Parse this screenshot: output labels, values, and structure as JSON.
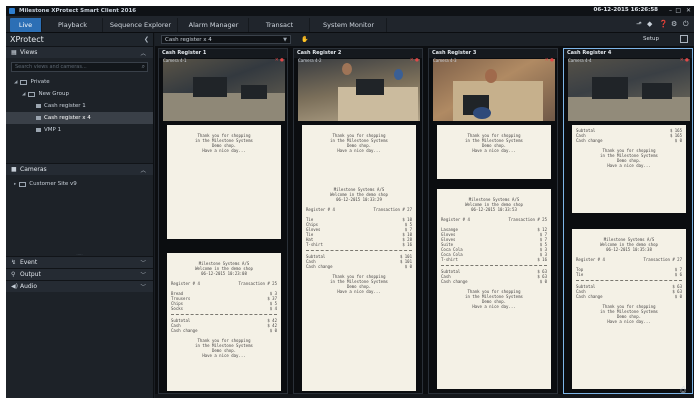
{
  "titlebar": {
    "title": "Milestone XProtect Smart Client 2016",
    "datetime": "06-12-2015 16:26:58"
  },
  "tabs": [
    "Live",
    "Playback",
    "Sequence Explorer",
    "Alarm Manager",
    "Transact",
    "System Monitor"
  ],
  "left": {
    "brand": "XProtect",
    "views_label": "Views",
    "search_placeholder": "Search views and cameras...",
    "tree": {
      "private": "Private",
      "group": "New Group",
      "items": [
        "Cash register 1",
        "Cash register x 4",
        "VMP 1"
      ]
    },
    "cameras_label": "Cameras",
    "site": "Customer Site v9",
    "sections": [
      "Event",
      "Output",
      "Audio"
    ]
  },
  "view": {
    "selected": "Cash register x 4",
    "setup": "Setup"
  },
  "cameras": [
    {
      "title": "Cash Register 1",
      "sub": "Camera 4-1",
      "top": [
        "Thank you for shopping",
        "in the Milestone Systems",
        "Demo shop.",
        "Have a nice day..."
      ],
      "header": [
        "Milestone Systems A/S",
        "Welcome in the demo shop",
        "06-12-2015 10:23:08"
      ],
      "register": [
        "Register # 4",
        "Transaction # 25"
      ],
      "items": [
        [
          "Bread",
          "$ 3"
        ],
        [
          "Trousers",
          "$ 37"
        ],
        [
          "Chips",
          "$ 5"
        ],
        [
          "Socks",
          "$ 4"
        ]
      ],
      "totals": [
        [
          "Subtotal",
          "$ 42"
        ],
        [
          "Cash",
          "$ 42"
        ],
        [
          "Cash change",
          "$ 0"
        ]
      ],
      "bottom": [
        "Thank you for shopping",
        "in the Milestone Systems",
        "Demo shop.",
        "Have a nice day..."
      ]
    },
    {
      "title": "Cash Register 2",
      "sub": "Camera 4-2",
      "top": [
        "Thank you for shopping",
        "in the Milestone Systems",
        "Demo shop.",
        "Have a nice day..."
      ],
      "header": [
        "Milestone Systems A/S",
        "Welcome in the demo shop",
        "06-12-2015 10:33:29"
      ],
      "register": [
        "Register # 4",
        "Transaction # 27"
      ],
      "items": [
        [
          "Tie",
          "$ 10"
        ],
        [
          "Chips",
          "$ 5"
        ],
        [
          "Gloves",
          "$ 7"
        ],
        [
          "Tie",
          "$ 10"
        ],
        [
          "Hat",
          "$ 28"
        ],
        [
          "T-shirt",
          "$ 16"
        ]
      ],
      "totals": [
        [
          "Subtotal",
          "$ 101"
        ],
        [
          "Cash",
          "$ 101"
        ],
        [
          "Cash change",
          "$ 0"
        ]
      ],
      "bottom": [
        "Thank you for shopping",
        "in the Milestone Systems",
        "Demo shop.",
        "Have a nice day..."
      ]
    },
    {
      "title": "Cash Register 3",
      "sub": "Camera 4-3",
      "top": [
        "Thank you for shopping",
        "in the Milestone Systems",
        "Demo shop.",
        "Have a nice day..."
      ],
      "header": [
        "Milestone Systems A/S",
        "Welcome in the demo shop",
        "06-12-2015 10:33:53"
      ],
      "register": [
        "Register # 4",
        "Transaction # 25"
      ],
      "items": [
        [
          "Lasange",
          "$ 12"
        ],
        [
          "Gloves",
          "$ 7"
        ],
        [
          "Gloves",
          "$ 7"
        ],
        [
          "Suite",
          "$ 5"
        ],
        [
          "Coca Cola",
          "$ 3"
        ],
        [
          "Coca Cola",
          "$ 3"
        ],
        [
          "T-shirt",
          "$ 16"
        ]
      ],
      "totals": [
        [
          "Subtotal",
          "$ 63"
        ],
        [
          "Cash",
          "$ 63"
        ],
        [
          "Cash change",
          "$ 0"
        ]
      ],
      "bottom": [
        "Thank you for shopping",
        "in the Milestone Systems",
        "Demo shop.",
        "Have a nice day..."
      ]
    },
    {
      "title": "Cash Register 4",
      "sub": "Camera 4-4",
      "top": [
        "Subtotal",
        "Cash",
        "Cash change"
      ],
      "topvals": [
        "$ 165",
        "$ 165",
        "$ 0"
      ],
      "topfoot": [
        "Thank you for shopping",
        "in the Milestone Systems",
        "Demo shop.",
        "Have a nice day..."
      ],
      "header": [
        "Milestone Systems A/S",
        "Welcome in the demo shop",
        "06-12-2015 10:35:38"
      ],
      "register": [
        "Register # 4",
        "Transaction # 27"
      ],
      "items": [
        [
          "Top",
          "$ 7"
        ],
        [
          "Tie",
          "$ 6"
        ]
      ],
      "totals": [
        [
          "Subtotal",
          "$ 63"
        ],
        [
          "Cash",
          "$ 63"
        ],
        [
          "Cash change",
          "$ 0"
        ]
      ],
      "bottom": [
        "Thank you for shopping",
        "in the Milestone Systems",
        "Demo shop.",
        "Have a nice day..."
      ]
    }
  ],
  "colors": {
    "accent": "#2c6fb5",
    "receipt": "#f4f1e6",
    "close": "#e04848"
  },
  "icons": [
    "back-arrow-icon",
    "settings-gear-icon",
    "help-icon",
    "full-screen-icon",
    "print-icon"
  ]
}
